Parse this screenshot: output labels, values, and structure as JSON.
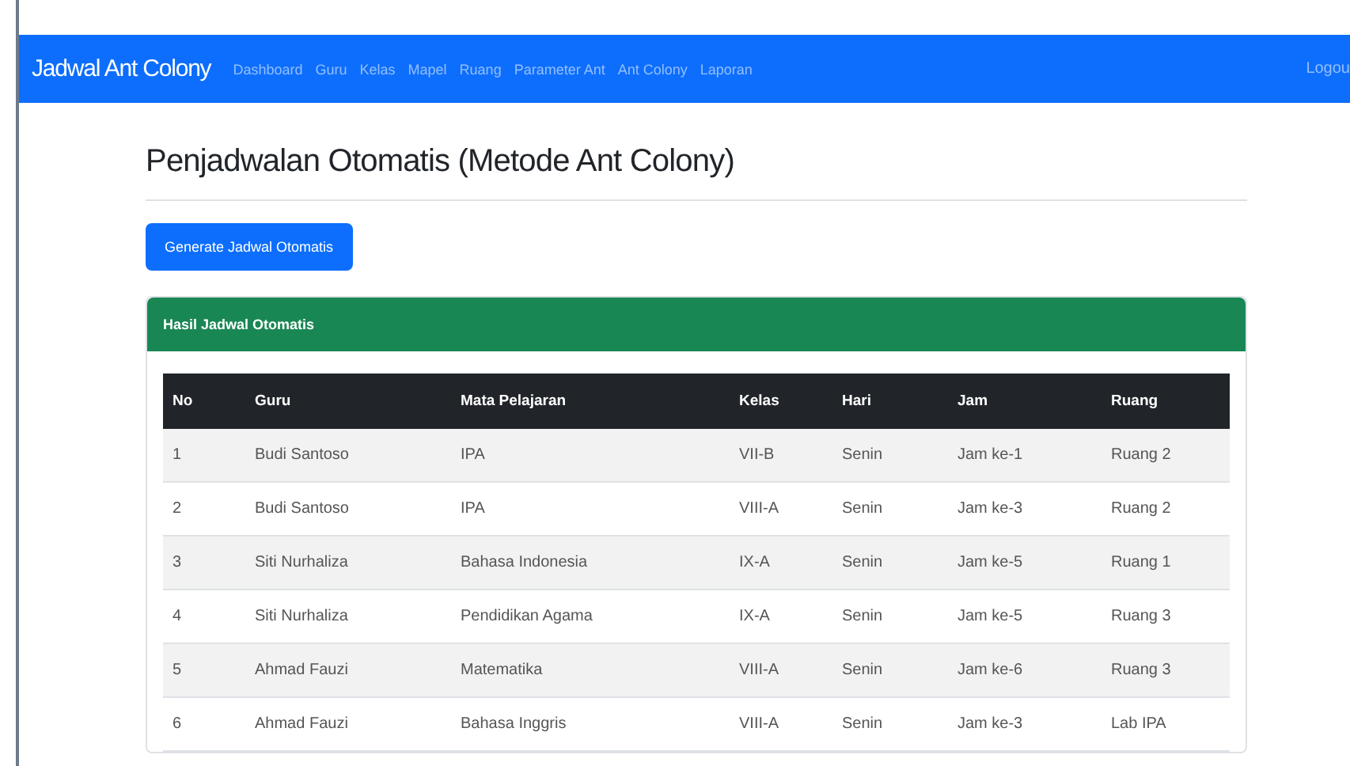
{
  "navbar": {
    "brand": "Jadwal Ant Colony",
    "items": [
      "Dashboard",
      "Guru",
      "Kelas",
      "Mapel",
      "Ruang",
      "Parameter Ant",
      "Ant Colony",
      "Laporan"
    ],
    "right": "Logou"
  },
  "title": "Penjadwalan Otomatis (Metode Ant Colony)",
  "generate_button": "Generate Jadwal Otomatis",
  "card": {
    "header": "Hasil Jadwal Otomatis",
    "table": {
      "columns": [
        "No",
        "Guru",
        "Mata Pelajaran",
        "Kelas",
        "Hari",
        "Jam",
        "Ruang"
      ],
      "rows": [
        [
          "1",
          "Budi Santoso",
          "IPA",
          "VII-B",
          "Senin",
          "Jam ke-1",
          "Ruang 2"
        ],
        [
          "2",
          "Budi Santoso",
          "IPA",
          "VIII-A",
          "Senin",
          "Jam ke-3",
          "Ruang 2"
        ],
        [
          "3",
          "Siti Nurhaliza",
          "Bahasa Indonesia",
          "IX-A",
          "Senin",
          "Jam ke-5",
          "Ruang 1"
        ],
        [
          "4",
          "Siti Nurhaliza",
          "Pendidikan Agama",
          "IX-A",
          "Senin",
          "Jam ke-5",
          "Ruang 3"
        ],
        [
          "5",
          "Ahmad Fauzi",
          "Matematika",
          "VIII-A",
          "Senin",
          "Jam ke-6",
          "Ruang 3"
        ],
        [
          "6",
          "Ahmad Fauzi",
          "Bahasa Inggris",
          "VIII-A",
          "Senin",
          "Jam ke-3",
          "Lab IPA"
        ]
      ]
    }
  }
}
